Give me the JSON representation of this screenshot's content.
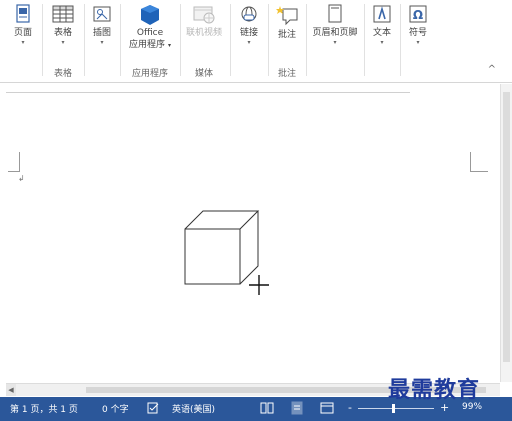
{
  "ribbon": {
    "page": {
      "label": "页面"
    },
    "table": {
      "label": "表格"
    },
    "illustration": {
      "label": "插图"
    },
    "office": {
      "line1": "Office",
      "line2": "应用程序"
    },
    "online_video": {
      "label": "联机视频"
    },
    "link": {
      "label": "链接"
    },
    "comment": {
      "label": "批注"
    },
    "header_footer": {
      "label": "页眉和页脚"
    },
    "text": {
      "label": "文本"
    },
    "symbol": {
      "label": "符号"
    },
    "groups": {
      "table": "表格",
      "apps": "应用程序",
      "media": "媒体",
      "comments": "批注"
    },
    "dropdown_glyph": "▾",
    "collapse_glyph": "^"
  },
  "document": {
    "paragraph_mark": "↲"
  },
  "status_bar": {
    "page_info": "第 1 页，共 1 页",
    "word_count": "0 个字",
    "language": "英语(美国)",
    "zoom_minus": "-",
    "zoom_plus": "+",
    "zoom_level": "99%"
  },
  "watermark": "最需教育",
  "colors": {
    "status_bar": "#2b579a",
    "office_icon": "#1f63b8",
    "watermark": "#1f3b9c"
  }
}
